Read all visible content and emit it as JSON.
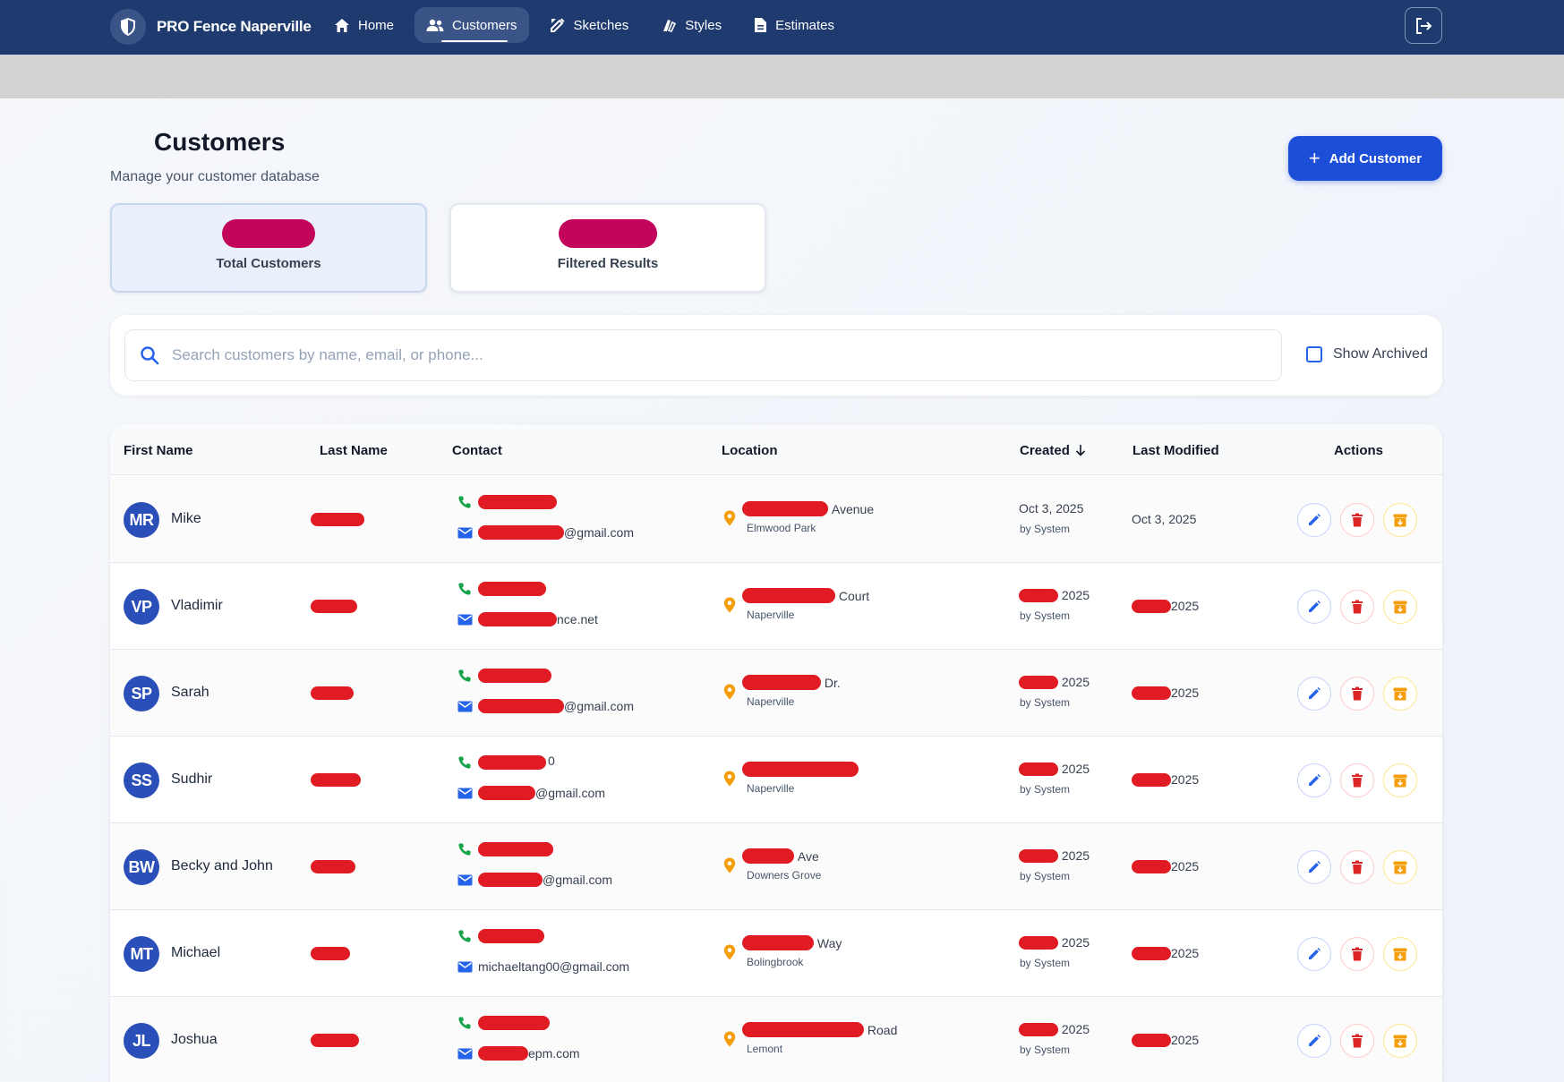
{
  "nav": {
    "brand": "PRO Fence Naperville",
    "items": [
      {
        "label": "Home",
        "icon": "home-icon",
        "active": false
      },
      {
        "label": "Customers",
        "icon": "users-icon",
        "active": true
      },
      {
        "label": "Sketches",
        "icon": "pencil-ruler-icon",
        "active": false
      },
      {
        "label": "Styles",
        "icon": "palette-icon",
        "active": false
      },
      {
        "label": "Estimates",
        "icon": "document-icon",
        "active": false
      }
    ],
    "logout_icon": "logout-icon"
  },
  "header": {
    "title": "Customers",
    "subtitle": "Manage your customer database",
    "add_button": "Add Customer"
  },
  "stats": {
    "total_label": "Total Customers",
    "total_value": "",
    "filtered_label": "Filtered Results",
    "filtered_value": ""
  },
  "search": {
    "placeholder": "Search customers by name, email, or phone...",
    "value": "",
    "show_archived_label": "Show Archived",
    "show_archived_checked": false
  },
  "table": {
    "columns": {
      "first_name": "First Name",
      "last_name": "Last Name",
      "contact": "Contact",
      "location": "Location",
      "created": "Created",
      "last_modified": "Last Modified",
      "actions": "Actions"
    },
    "sort_column": "Created",
    "sort_direction": "desc",
    "rows": [
      {
        "initials": "MR",
        "first_name": "Mike",
        "email_suffix": "@gmail.com",
        "address_suffix": "Avenue",
        "city": "Elmwood Park",
        "created": "Oct 3, 2025",
        "created_by": "by System",
        "modified": "Oct 3, 2025"
      },
      {
        "initials": "VP",
        "first_name": "Vladimir",
        "email_suffix": "nce.net",
        "address_suffix": "Court",
        "city": "Naperville",
        "created": "2025",
        "created_by": "by System",
        "modified": "2025"
      },
      {
        "initials": "SP",
        "first_name": "Sarah",
        "email_suffix": "@gmail.com",
        "address_suffix": "Dr.",
        "city": "Naperville",
        "created": "2025",
        "created_by": "by System",
        "modified": "2025"
      },
      {
        "initials": "SS",
        "first_name": "Sudhir",
        "phone_suffix": "0",
        "email_suffix": "@gmail.com",
        "address_suffix": "",
        "city": "Naperville",
        "created": "2025",
        "created_by": "by System",
        "modified": "2025"
      },
      {
        "initials": "BW",
        "first_name": "Becky and John",
        "email_suffix": "@gmail.com",
        "address_suffix": "Ave",
        "city": "Downers Grove",
        "created": "2025",
        "created_by": "by System",
        "modified": "2025"
      },
      {
        "initials": "MT",
        "first_name": "Michael",
        "email": "michaeltang00@gmail.com",
        "address_suffix": "Way",
        "city": "Bolingbrook",
        "created": "2025",
        "created_by": "by System",
        "modified": "2025"
      },
      {
        "initials": "JL",
        "first_name": "Joshua",
        "email_suffix": "epm.com",
        "address_suffix": "Road",
        "city": "Lemont",
        "created": "2025",
        "created_by": "by System",
        "modified": "2025"
      }
    ]
  },
  "colors": {
    "navbar": "#1e3a6e",
    "primary": "#1d4ed8",
    "avatar": "#2a4fb8",
    "redaction": "#e01b24",
    "stat_redaction": "#c2045a",
    "phone_icon": "#16a34a",
    "mail_icon": "#2563eb",
    "pin_icon": "#f59e0b",
    "delete": "#dc2626",
    "archive": "#f59e0b"
  }
}
